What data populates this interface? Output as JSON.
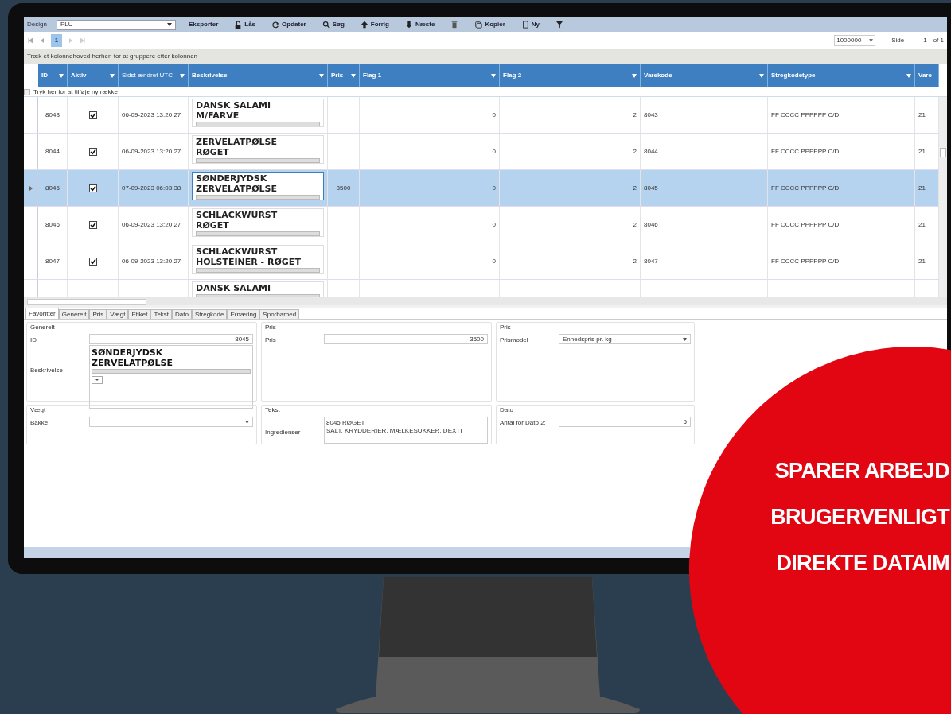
{
  "toolbar": {
    "label": "Design",
    "combo": "PLU",
    "buttons": [
      {
        "kind": "plain",
        "label": "Eksporter"
      },
      {
        "kind": "lock",
        "label": "Lås"
      },
      {
        "kind": "refresh",
        "label": "Opdater"
      },
      {
        "kind": "search",
        "label": "Søg"
      },
      {
        "kind": "up",
        "label": "Forrig"
      },
      {
        "kind": "down",
        "label": "Næste"
      },
      {
        "kind": "trash"
      },
      {
        "kind": "copy",
        "label": "Kopier"
      },
      {
        "kind": "new",
        "label": "Ny"
      },
      {
        "kind": "filter"
      }
    ]
  },
  "pager": {
    "page": "1",
    "page_size": "1000000",
    "side_label": "Side",
    "side_value": "1",
    "of": "of 1"
  },
  "group_hint": "Træk et kolonnehoved herhen for at gruppere efter kolonnen",
  "grid": {
    "columns": [
      "ID",
      "Aktiv",
      "Sidst ændret UTC",
      "Beskrivelse",
      "Pris",
      "Flag 1",
      "Flag 2",
      "Varekode",
      "Stregkodetype",
      "Vare"
    ],
    "new_row_hint": "Tryk her for at tilføje ny række",
    "rows": [
      {
        "id": "8043",
        "active": true,
        "changed": "06-09-2023 13:20:27",
        "description": [
          "DANSK SALAMI",
          "M/FARVE"
        ],
        "price": "",
        "flag1": "0",
        "flag2": "2",
        "code": "8043",
        "barcode": "FF CCCC PPPPPP C/D",
        "vare": "21",
        "selected": false
      },
      {
        "id": "8044",
        "active": true,
        "changed": "06-09-2023 13:20:27",
        "description": [
          "ZERVELATPØLSE",
          "RØGET"
        ],
        "price": "",
        "flag1": "0",
        "flag2": "2",
        "code": "8044",
        "barcode": "FF CCCC PPPPPP C/D",
        "vare": "21",
        "selected": false
      },
      {
        "id": "8045",
        "active": true,
        "changed": "07-09-2023 06:03:38",
        "description": [
          "SØNDERJYDSK",
          "ZERVELATPØLSE"
        ],
        "price": "3500",
        "flag1": "0",
        "flag2": "2",
        "code": "8045",
        "barcode": "FF CCCC PPPPPP C/D",
        "vare": "21",
        "selected": true
      },
      {
        "id": "8046",
        "active": true,
        "changed": "06-09-2023 13:20:27",
        "description": [
          "SCHLACKWURST",
          "RØGET"
        ],
        "price": "",
        "flag1": "0",
        "flag2": "2",
        "code": "8046",
        "barcode": "FF CCCC PPPPPP C/D",
        "vare": "21",
        "selected": false
      },
      {
        "id": "8047",
        "active": true,
        "changed": "06-09-2023 13:20:27",
        "description": [
          "SCHLACKWURST",
          "HOLSTEINER - RØGET"
        ],
        "price": "",
        "flag1": "0",
        "flag2": "2",
        "code": "8047",
        "barcode": "FF CCCC PPPPPP C/D",
        "vare": "21",
        "selected": false
      },
      {
        "description": [
          "DANSK SALAMI"
        ],
        "selected": false
      }
    ]
  },
  "tabs": [
    {
      "label": "Favoritter",
      "selected": true
    },
    {
      "label": "Generelt",
      "selected": false
    },
    {
      "label": "Pris",
      "selected": false
    },
    {
      "label": "Vægt",
      "selected": false
    },
    {
      "label": "Etiket",
      "selected": false
    },
    {
      "label": "Tekst",
      "selected": false
    },
    {
      "label": "Dato",
      "selected": false
    },
    {
      "label": "Stregkode",
      "selected": false
    },
    {
      "label": "Ernæring",
      "selected": false
    },
    {
      "label": "Sporbarhed",
      "selected": false
    }
  ],
  "groups": [
    {
      "title": "Generelt",
      "fields": [
        {
          "kind": "text",
          "label": "ID",
          "value": "8045"
        },
        {
          "kind": "rich",
          "label": "Beskrivelse",
          "lines": [
            "SØNDERJYDSK",
            "ZERVELATPØLSE"
          ]
        }
      ]
    },
    {
      "title": "Pris",
      "fields": [
        {
          "kind": "text",
          "label": "Pris",
          "value": "3500"
        }
      ]
    },
    {
      "title": "Pris",
      "fields": [
        {
          "kind": "select",
          "label": "Prismodel",
          "value": "Enhedspris pr. kg"
        }
      ]
    },
    {
      "title": "Vægt",
      "fields": [
        {
          "kind": "select",
          "label": "Bakke"
        }
      ]
    },
    {
      "title": "Tekst",
      "fields": [
        {
          "kind": "memo",
          "label": "Ingredienser",
          "lines": [
            "8045 RØGET",
            "SALT, KRYDDERIER, MÆLKESUKKER, DEXTI"
          ]
        }
      ]
    },
    {
      "title": "Dato",
      "fields": [
        {
          "kind": "text",
          "label": "Antal for Dato 2:",
          "value": "5"
        }
      ]
    }
  ],
  "promo": [
    "SPARER ARBEJD",
    "BRUGERVENLIGT",
    "DIREKTE DATAIM"
  ]
}
